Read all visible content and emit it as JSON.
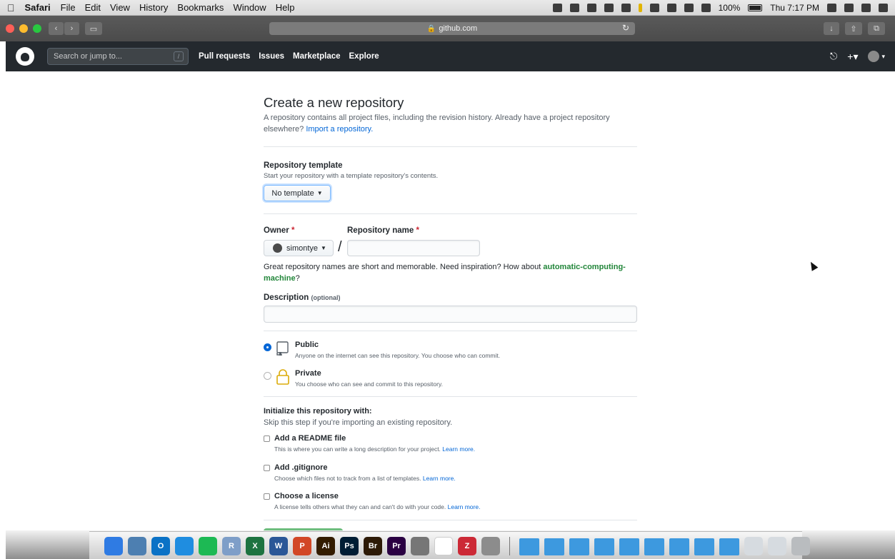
{
  "menubar": {
    "apple": "",
    "app": "Safari",
    "items": [
      "File",
      "Edit",
      "View",
      "History",
      "Bookmarks",
      "Window",
      "Help"
    ],
    "battery": "100%",
    "clock": "Thu 7:17 PM"
  },
  "safari": {
    "url": "github.com",
    "lock_icon": "lock-icon",
    "reload": "↻"
  },
  "github": {
    "search_placeholder": "Search or jump to...",
    "search_key": "/",
    "nav": [
      "Pull requests",
      "Issues",
      "Marketplace",
      "Explore"
    ],
    "bell": "🔔",
    "plus": "+▾",
    "avatar_caret": "▾"
  },
  "page": {
    "title": "Create a new repository",
    "lead_text": "A repository contains all project files, including the revision history. Already have a project repository elsewhere?",
    "lead_link": "Import a repository.",
    "template_label": "Repository template",
    "template_note": "Start your repository with a template repository's contents.",
    "template_button": "No template",
    "owner_label": "Owner",
    "owner_required": "*",
    "owner_value": "simontye",
    "slash": "/",
    "repo_name_label": "Repository name",
    "repo_name_required": "*",
    "repo_name_value": "",
    "suggestion_text": "Great repository names are short and memorable. Need inspiration? How about",
    "suggestion_name": "automatic-computing-machine",
    "suggestion_end": "?",
    "description_label": "Description",
    "description_optional": "(optional)",
    "description_value": "",
    "public_title": "Public",
    "public_note": "Anyone on the internet can see this repository. You choose who can commit.",
    "private_title": "Private",
    "private_note": "You choose who can see and commit to this repository.",
    "init_label": "Initialize this repository with:",
    "init_note": "Skip this step if you're importing an existing repository.",
    "readme_title": "Add a README file",
    "readme_note": "This is where you can write a long description for your project.",
    "gitignore_title": "Add .gitignore",
    "gitignore_note": "Choose which files not to track from a list of templates.",
    "license_title": "Choose a license",
    "license_note": "A license tells others what they can and can't do with your code.",
    "learn_more": "Learn more."
  },
  "dock": {
    "apps": [
      {
        "name": "finder-icon",
        "label": "",
        "color": "#2f7be3"
      },
      {
        "name": "preview-icon",
        "label": "",
        "color": "#4d7fb1"
      },
      {
        "name": "outlook-icon",
        "label": "O",
        "color": "#0b72c6"
      },
      {
        "name": "safari-icon",
        "label": "",
        "color": "#1f8de0"
      },
      {
        "name": "spotify-icon",
        "label": "",
        "color": "#1db954"
      },
      {
        "name": "r-icon",
        "label": "R",
        "color": "#7e9ec8"
      },
      {
        "name": "excel-icon",
        "label": "X",
        "color": "#1d7340"
      },
      {
        "name": "word-icon",
        "label": "W",
        "color": "#2b5797"
      },
      {
        "name": "powerpoint-icon",
        "label": "P",
        "color": "#d24726"
      },
      {
        "name": "illustrator-icon",
        "label": "Ai",
        "color": "#331c00"
      },
      {
        "name": "photoshop-icon",
        "label": "Ps",
        "color": "#001d34"
      },
      {
        "name": "bridge-icon",
        "label": "Br",
        "color": "#2d1a06"
      },
      {
        "name": "premiere-icon",
        "label": "Pr",
        "color": "#2a0042"
      },
      {
        "name": "mimestream-icon",
        "label": "",
        "color": "#767676"
      },
      {
        "name": "slack-icon",
        "label": "",
        "color": "#ffffff"
      },
      {
        "name": "zotero-icon",
        "label": "Z",
        "color": "#cc2936"
      },
      {
        "name": "system-preferences-icon",
        "label": "",
        "color": "#8c8c8c"
      }
    ],
    "folders": 9
  }
}
